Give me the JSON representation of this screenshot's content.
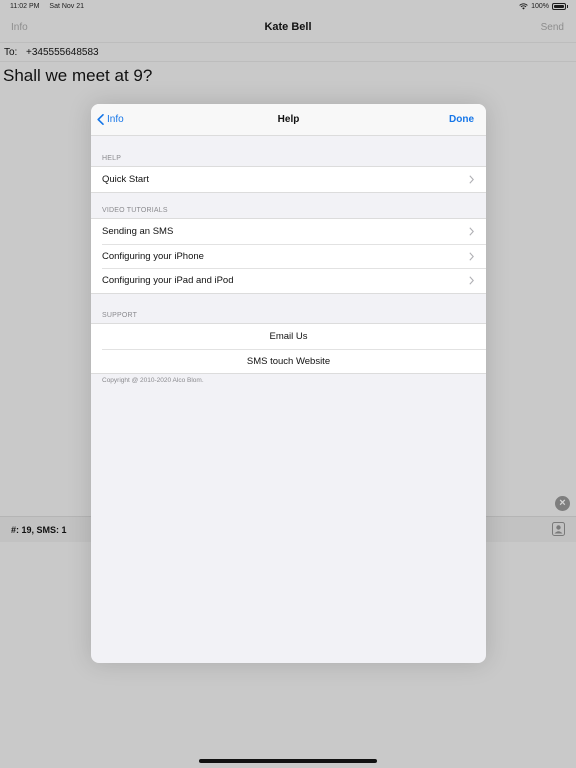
{
  "status_bar": {
    "time": "11:02 PM",
    "date": "Sat Nov 21",
    "battery": "100%"
  },
  "compose": {
    "nav_left": "Info",
    "title": "Kate Bell",
    "nav_right": "Send",
    "to_label": "To:",
    "to_value": "+345555648583",
    "message": "Shall we meet at 9?",
    "counter": "#: 19, SMS: 1"
  },
  "help_sheet": {
    "back_label": "Info",
    "title": "Help",
    "done_label": "Done",
    "sections": [
      {
        "header": "HELP",
        "items": [
          "Quick Start"
        ]
      },
      {
        "header": "VIDEO TUTORIALS",
        "items": [
          "Sending an SMS",
          "Configuring your iPhone",
          "Configuring your iPad and iPod"
        ]
      },
      {
        "header": "SUPPORT",
        "items": [
          "Email Us",
          "SMS touch Website"
        ]
      }
    ],
    "footer": "Copyright @ 2010-2020 Alco Blom."
  },
  "colors": {
    "accent": "#1676e8",
    "dimmed_background": "#c9c9c9",
    "sheet_background": "#f2f2f6"
  },
  "icons": [
    "wifi-icon",
    "battery-icon",
    "chevron-left-icon",
    "chevron-right-icon",
    "clear-icon",
    "contact-icon"
  ]
}
